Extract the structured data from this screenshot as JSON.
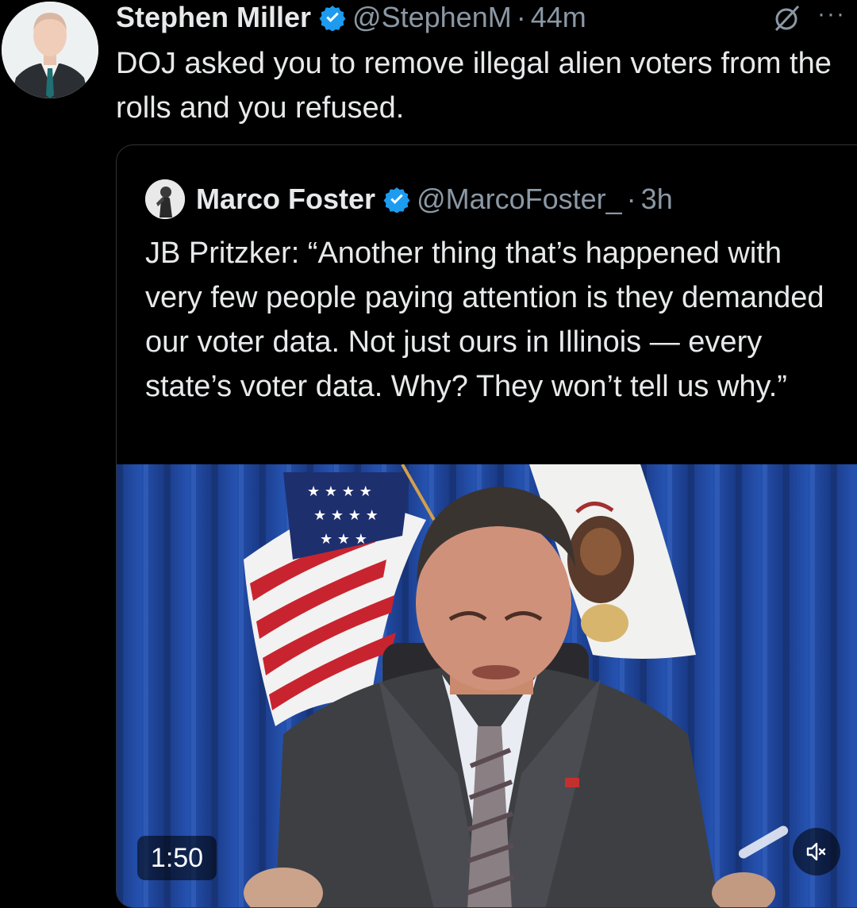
{
  "tweet": {
    "display_name": "Stephen Miller",
    "handle": "@StephenM",
    "separator": "·",
    "time": "44m",
    "text": "DOJ asked you to remove illegal alien voters from the rolls and you refused.",
    "verified": true
  },
  "quoted_tweet": {
    "display_name": "Marco Foster",
    "handle": "@MarcoFoster_",
    "separator": "·",
    "time": "3h",
    "text": "JB Pritzker: “Another thing that’s happened with very few people paying attention is they demanded our voter data. Not just ours in Illinois — every state’s voter data. Why? They won’t tell us why.”",
    "verified": true
  },
  "video": {
    "duration": "1:50",
    "mute_icon": "speaker-muted-icon"
  },
  "icons": {
    "verified": "verified-badge-icon",
    "grok": "grok-icon",
    "more": "more-icon"
  },
  "colors": {
    "background": "#000000",
    "text": "#e7e9ea",
    "secondary": "#8b98a5",
    "verified": "#1d9bf0",
    "border": "#2f3336"
  }
}
